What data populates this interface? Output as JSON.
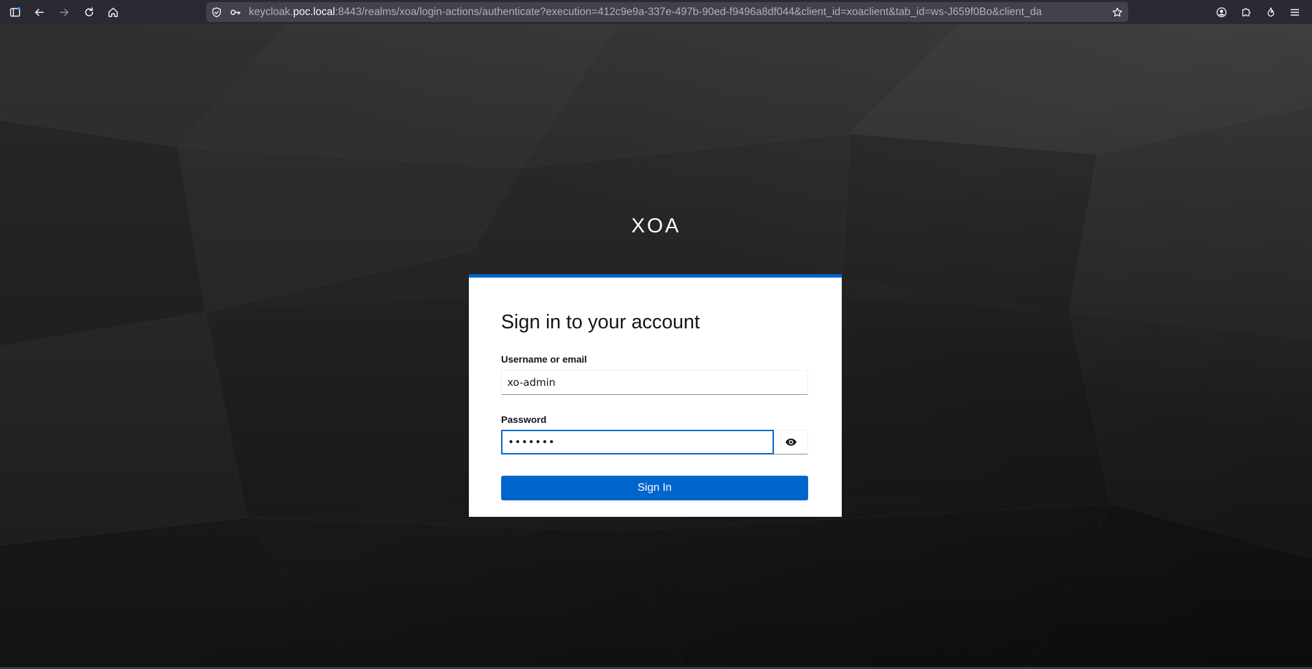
{
  "browser": {
    "url_host_prefix": "keycloak.",
    "url_host": "poc.local",
    "url_rest": ":8443/realms/xoa/login-actions/authenticate?execution=412c9e9a-337e-497b-90ed-f9496a8df044&client_id=xoaclient&tab_id=ws-J659f0Bo&client_da",
    "icons": {
      "sidebar": "sidebar-icon",
      "back": "back-arrow-icon",
      "forward": "forward-arrow-icon",
      "reload": "reload-icon",
      "home": "home-icon",
      "shield": "shield-icon",
      "key": "key-icon",
      "bookmark": "star-icon",
      "account": "account-icon",
      "extensions": "puzzle-icon",
      "firefox-view": "flame-icon",
      "menu": "hamburger-menu-icon"
    }
  },
  "login": {
    "realm_title": "XOA",
    "heading": "Sign in to your account",
    "username_label": "Username or email",
    "username_value": "xo-admin",
    "password_label": "Password",
    "password_value": "•••••••",
    "show_password_icon": "eye-icon",
    "submit_label": "Sign In"
  },
  "colors": {
    "accent": "#0066cc",
    "card_background": "#ffffff",
    "page_background": "#232323",
    "browser_toolbar": "#2b2a33"
  }
}
